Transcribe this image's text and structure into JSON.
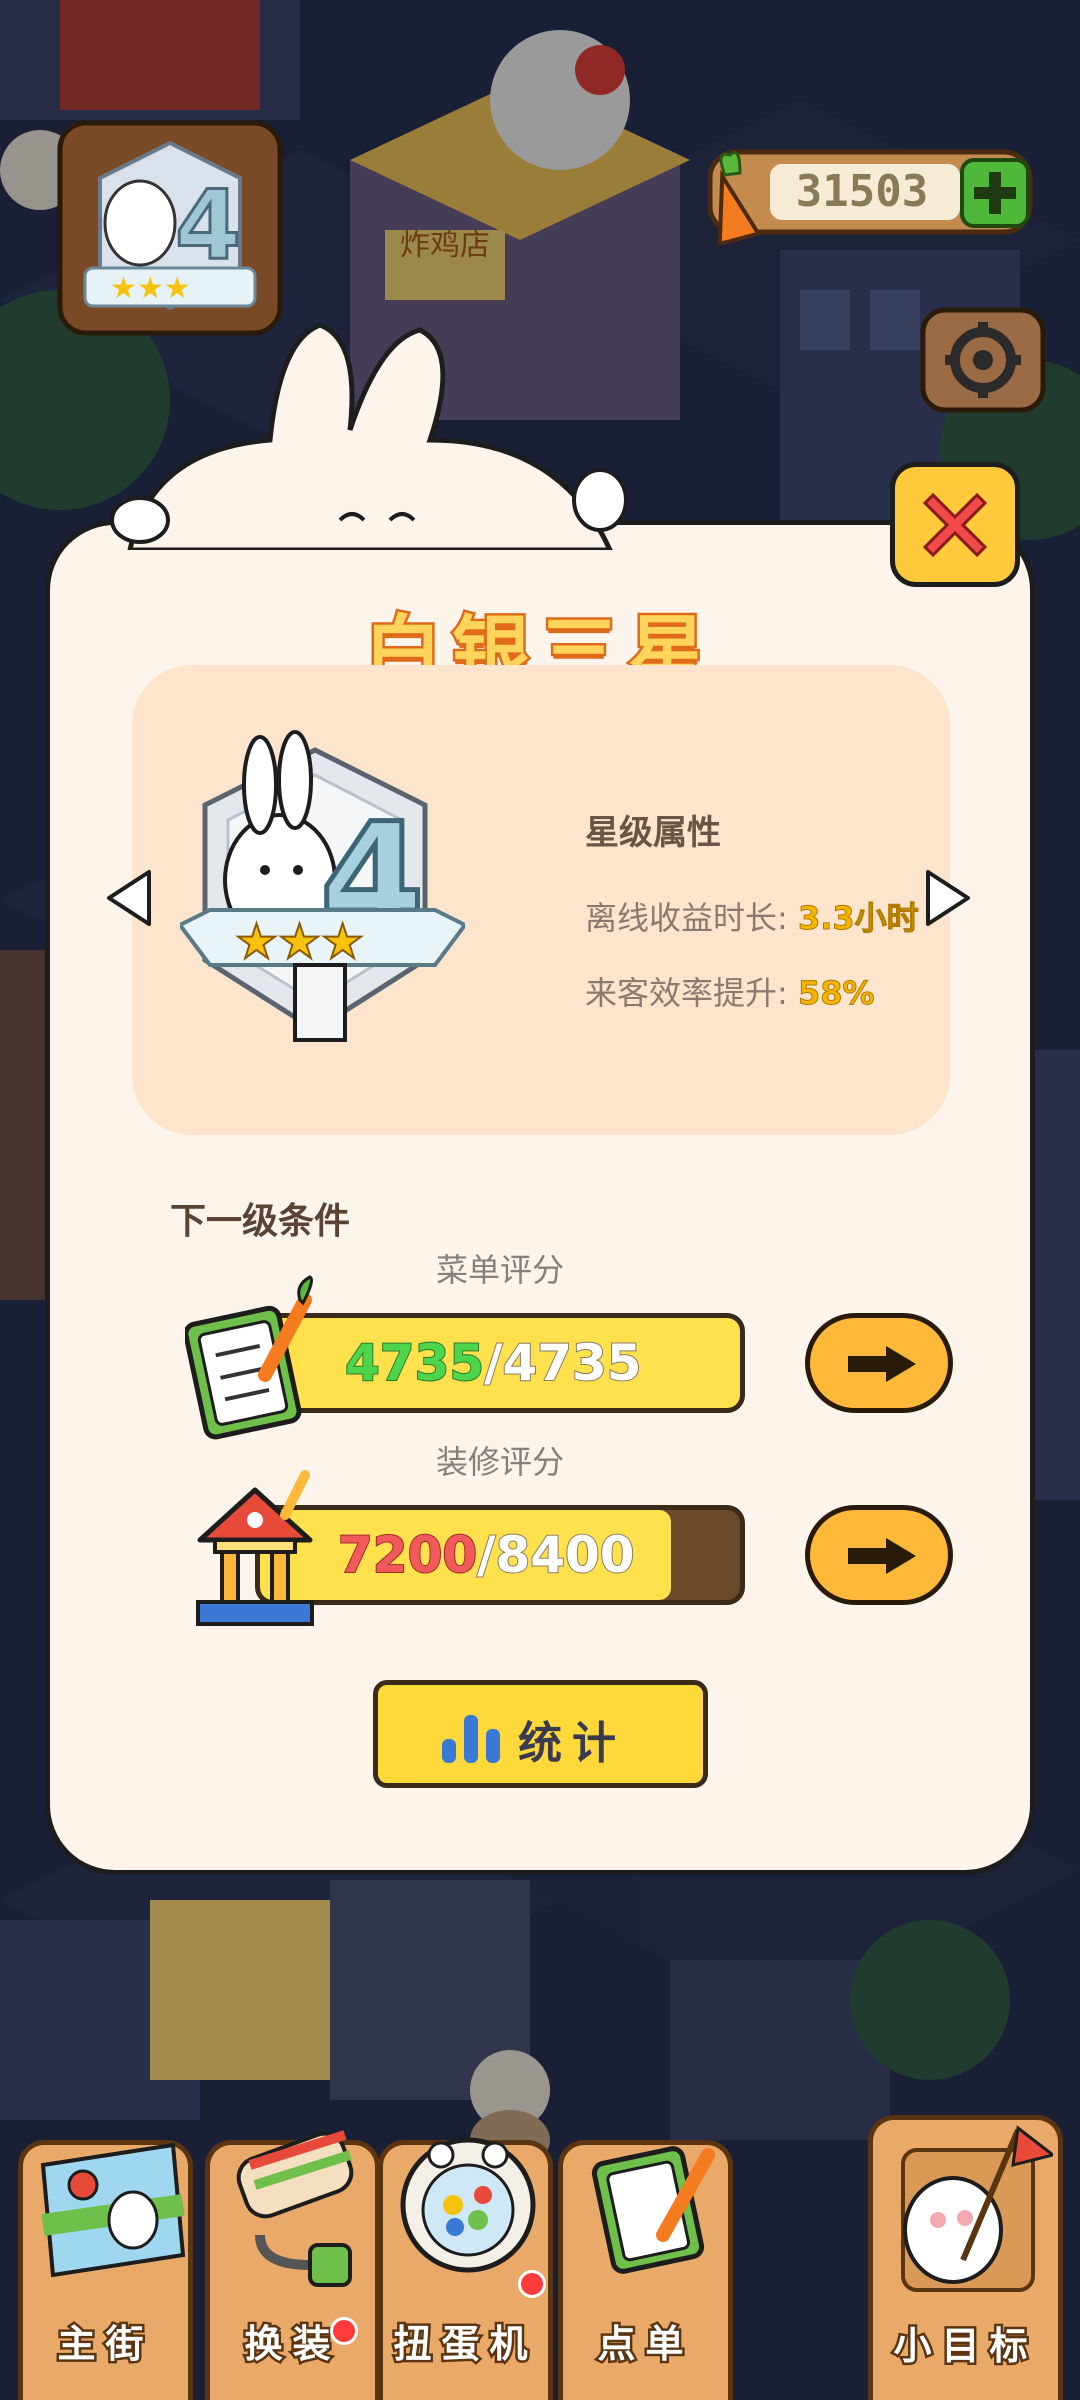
{
  "hud": {
    "currency_amount": "31503",
    "currency_icon": "carrot-icon",
    "add_icon": "plus-icon",
    "settings_icon": "gear-icon",
    "level_stars": 3,
    "level_number": "4"
  },
  "dialog": {
    "title": "白银三星",
    "badge_level": "4",
    "badge_stars": 3,
    "attributes": {
      "heading": "星级属性",
      "offline_label": "离线收益时长:",
      "offline_value": "3.3小时",
      "efficiency_label": "来客效率提升:",
      "efficiency_value": "58%"
    },
    "next_level": {
      "heading": "下一级条件",
      "menu": {
        "label": "菜单评分",
        "current": "4735",
        "total": "4735",
        "ratio": 1.0
      },
      "decor": {
        "label": "装修评分",
        "current": "7200",
        "total": "8400",
        "ratio": 0.857
      }
    },
    "stats_button": "统计",
    "close_icon": "close-icon"
  },
  "nav": {
    "tabs": [
      {
        "label": "主街",
        "icon": "map-icon",
        "badge": false
      },
      {
        "label": "换装",
        "icon": "paint-roller-icon",
        "badge": true
      },
      {
        "label": "扭蛋机",
        "icon": "gacha-machine-icon",
        "badge": true
      },
      {
        "label": "点单",
        "icon": "order-clipboard-icon",
        "badge": false
      },
      {
        "label": "小目标",
        "icon": "goal-flag-icon",
        "badge": false
      }
    ]
  },
  "colors": {
    "dialog_bg": "#fdf5ec",
    "card_bg": "#fde4cc",
    "accent_yellow": "#ffe14d",
    "button_orange": "#ffb83a",
    "complete_green": "#4dd64d",
    "incomplete_red": "#f05a5a"
  }
}
